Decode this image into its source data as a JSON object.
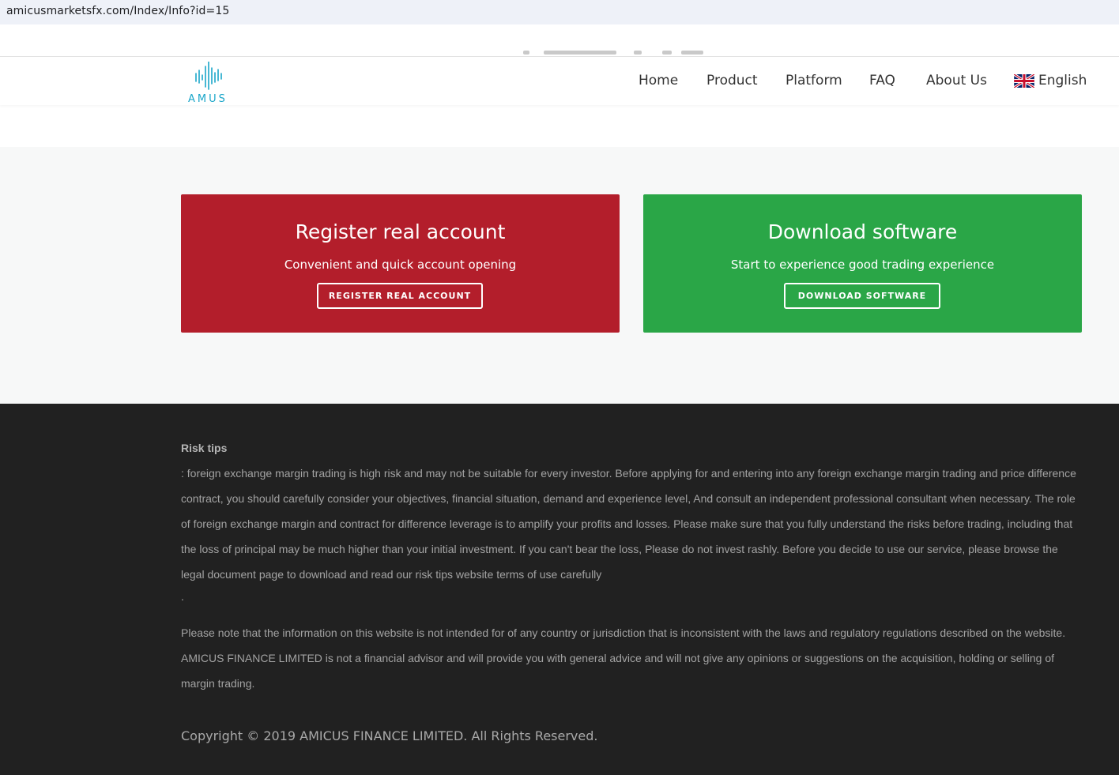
{
  "browser": {
    "url": "amicusmarketsfx.com/Index/Info?id=15"
  },
  "header": {
    "logo_text": "AMUS",
    "nav": [
      {
        "label": "Home"
      },
      {
        "label": "Product"
      },
      {
        "label": "Platform"
      },
      {
        "label": "FAQ"
      },
      {
        "label": "About Us"
      }
    ],
    "language": {
      "label": "English",
      "flag_icon": "uk-flag-icon"
    }
  },
  "cta": {
    "register": {
      "title": "Register real account",
      "subtitle": "Convenient and quick account opening",
      "button": "REGISTER REAL ACCOUNT",
      "color": "#b31e2b"
    },
    "download": {
      "title": "Download software",
      "subtitle": "Start to experience good trading experience",
      "button": "DOWNLOAD SOFTWARE",
      "color": "#2aa647"
    }
  },
  "footer": {
    "risk_title": "Risk tips",
    "risk_text": ": foreign exchange margin trading is high risk and may not be suitable for every investor. Before applying for and entering into any foreign exchange margin trading and price difference contract, you should carefully consider your objectives, financial situation, demand and experience level, And consult an independent professional consultant when necessary. The role of foreign exchange margin and contract for difference leverage is to amplify your profits and losses. Please make sure that you fully understand the risks before trading, including that the loss of principal may be much higher than your initial investment. If you can't bear the loss, Please do not invest rashly. Before you decide to use our service, please browse the legal document page to download and read our risk tips website terms of use carefully",
    "risk_dot": ".",
    "note_text": "Please note that the information on this website is not intended for of any country or jurisdiction that is inconsistent with the laws and regulatory regulations described on the website. AMICUS FINANCE LIMITED is not a financial advisor and will provide you with general advice and will not give any opinions or suggestions on the acquisition, holding or selling of margin trading.",
    "copyright": "Copyright © 2019 AMICUS FINANCE LIMITED. All Rights Reserved.",
    "background_color": "#212121"
  }
}
